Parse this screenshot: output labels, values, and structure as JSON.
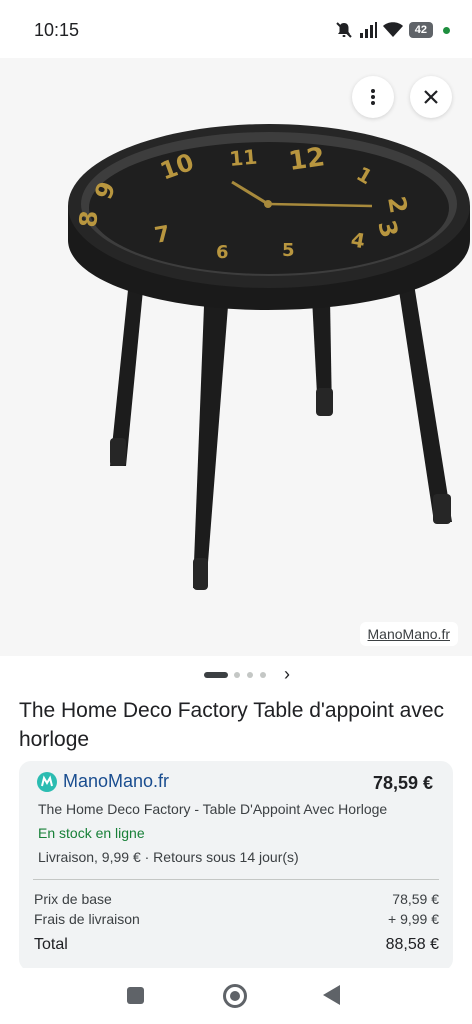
{
  "status_bar": {
    "time": "10:15",
    "battery": "42"
  },
  "image": {
    "source_label": "ManoMano.fr",
    "more_icon": "more-vert-icon",
    "close_icon": "close-icon"
  },
  "carousel": {
    "total_dots": 4,
    "active_index": 0
  },
  "product": {
    "title": "The Home Deco Factory Table d'appoint avec horloge"
  },
  "offer": {
    "merchant": "ManoMano.fr",
    "price": "78,59 €",
    "description": "The Home Deco Factory - Table D'Appoint Avec Horloge",
    "stock": "En stock en ligne",
    "delivery": "Livraison, 9,99 € · Retours sous 14 jour(s)",
    "breakdown": {
      "base_label": "Prix de base",
      "base_value": "78,59 €",
      "shipping_label": "Frais de livraison",
      "shipping_value": "+ 9,99 €",
      "total_label": "Total",
      "total_value": "88,58 €"
    }
  },
  "colors": {
    "accent_green": "#188038",
    "merchant_blue": "#1a4d8f"
  }
}
